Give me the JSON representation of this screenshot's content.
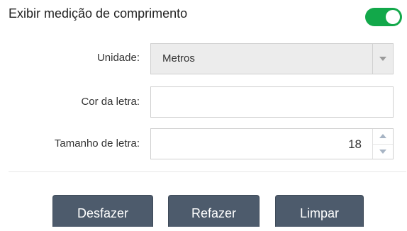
{
  "header": {
    "title": "Exibir medição de comprimento",
    "toggle_on": true
  },
  "form": {
    "unit_label": "Unidade:",
    "unit_value": "Metros",
    "font_color_label": "Cor da letra:",
    "font_color_value": "",
    "font_size_label": "Tamanho de letra:",
    "font_size_value": "18"
  },
  "actions": {
    "undo_label": "Desfazer",
    "redo_label": "Refazer",
    "clear_label": "Limpar"
  },
  "colors": {
    "toggle_on": "#12a84a",
    "button_bg": "#4d5b6c"
  }
}
